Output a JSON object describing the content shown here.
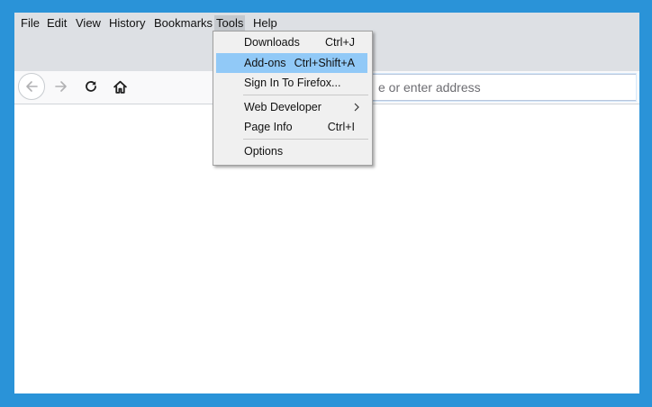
{
  "menubar": {
    "items": [
      {
        "label": "File"
      },
      {
        "label": "Edit"
      },
      {
        "label": "View"
      },
      {
        "label": "History"
      },
      {
        "label": "Bookmarks"
      },
      {
        "label": "Tools"
      },
      {
        "label": "Help"
      }
    ],
    "active": "Tools"
  },
  "toolbar": {
    "back_icon": "back-arrow-icon",
    "forward_icon": "forward-arrow-icon",
    "reload_icon": "reload-icon",
    "home_icon": "home-icon"
  },
  "urlbar": {
    "placeholder": "e or enter address",
    "value": ""
  },
  "tools_menu": {
    "items": [
      {
        "label": "Downloads",
        "shortcut": "Ctrl+J"
      },
      {
        "label": "Add-ons",
        "shortcut": "Ctrl+Shift+A",
        "highlighted": true
      },
      {
        "label": "Sign In To Firefox...",
        "shortcut": ""
      },
      {
        "label": "Web Developer",
        "shortcut": "",
        "submenu": true
      },
      {
        "label": "Page Info",
        "shortcut": "Ctrl+I"
      },
      {
        "label": "Options",
        "shortcut": ""
      }
    ]
  },
  "colors": {
    "desktop": "#2a93d8",
    "chrome": "#dde0e4",
    "menu_highlight": "#91c9f7"
  }
}
